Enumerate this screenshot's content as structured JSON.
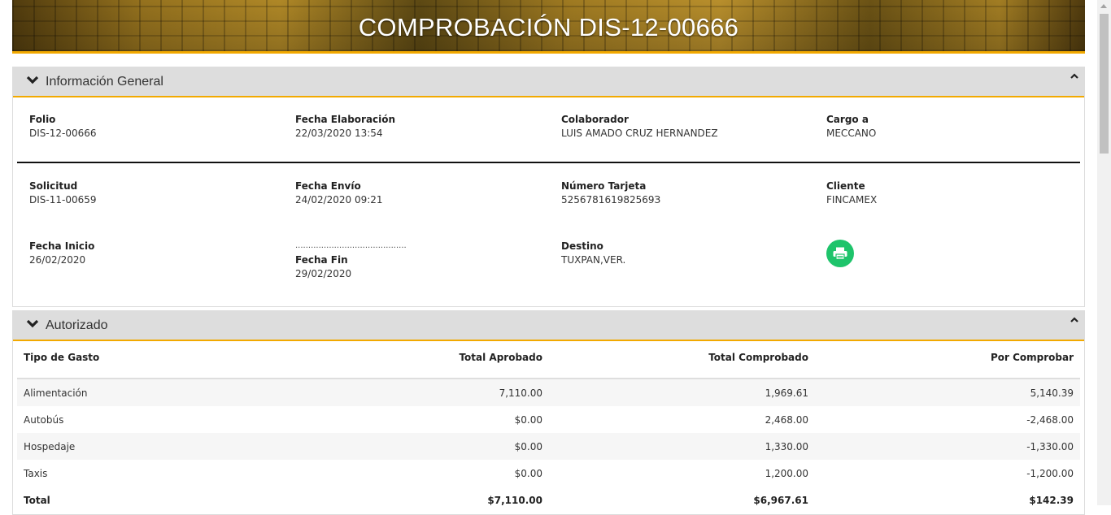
{
  "header": {
    "title": "COMPROBACIÓN DIS-12-00666"
  },
  "info": {
    "section_label": "Información General",
    "fields": {
      "folio": {
        "label": "Folio",
        "value": "DIS-12-00666"
      },
      "fecha_elaboracion": {
        "label": "Fecha Elaboración",
        "value": "22/03/2020 13:54"
      },
      "colaborador": {
        "label": "Colaborador",
        "value": "LUIS AMADO CRUZ HERNANDEZ"
      },
      "cargo_a": {
        "label": "Cargo a",
        "value": "MECCANO"
      },
      "solicitud": {
        "label": "Solicitud",
        "value": "DIS-11-00659"
      },
      "fecha_envio": {
        "label": "Fecha Envío",
        "value": "24/02/2020 09:21"
      },
      "numero_tarjeta": {
        "label": "Número Tarjeta",
        "value": "525678161982569З"
      },
      "cliente": {
        "label": "Cliente",
        "value": "FINCAMEX"
      },
      "fecha_inicio": {
        "label": "Fecha Inicio",
        "value": "26/02/2020"
      },
      "fecha_fin": {
        "label": "Fecha Fin",
        "value": "29/02/2020"
      },
      "destino": {
        "label": "Destino",
        "value": "TUXPAN,VER."
      }
    },
    "dots": "...........................................",
    "print_icon": "print-icon"
  },
  "autorizado": {
    "section_label": "Autorizado",
    "columns": [
      "Tipo de Gasto",
      "Total Aprobado",
      "Total Comprobado",
      "Por Comprobar"
    ],
    "rows": [
      [
        "Alimentación",
        "7,110.00",
        "1,969.61",
        "5,140.39"
      ],
      [
        "Autobús",
        "$0.00",
        "2,468.00",
        "-2,468.00"
      ],
      [
        "Hospedaje",
        "$0.00",
        "1,330.00",
        "-1,330.00"
      ],
      [
        "Taxis",
        "$0.00",
        "1,200.00",
        "-1,200.00"
      ]
    ],
    "total": [
      "Total",
      "$7,110.00",
      "$6,967.61",
      "$142.39"
    ]
  },
  "colors": {
    "accent": "#f2a900",
    "positive": "#1a8a1a",
    "negative": "#d11818",
    "print_button": "#1ec46b"
  }
}
